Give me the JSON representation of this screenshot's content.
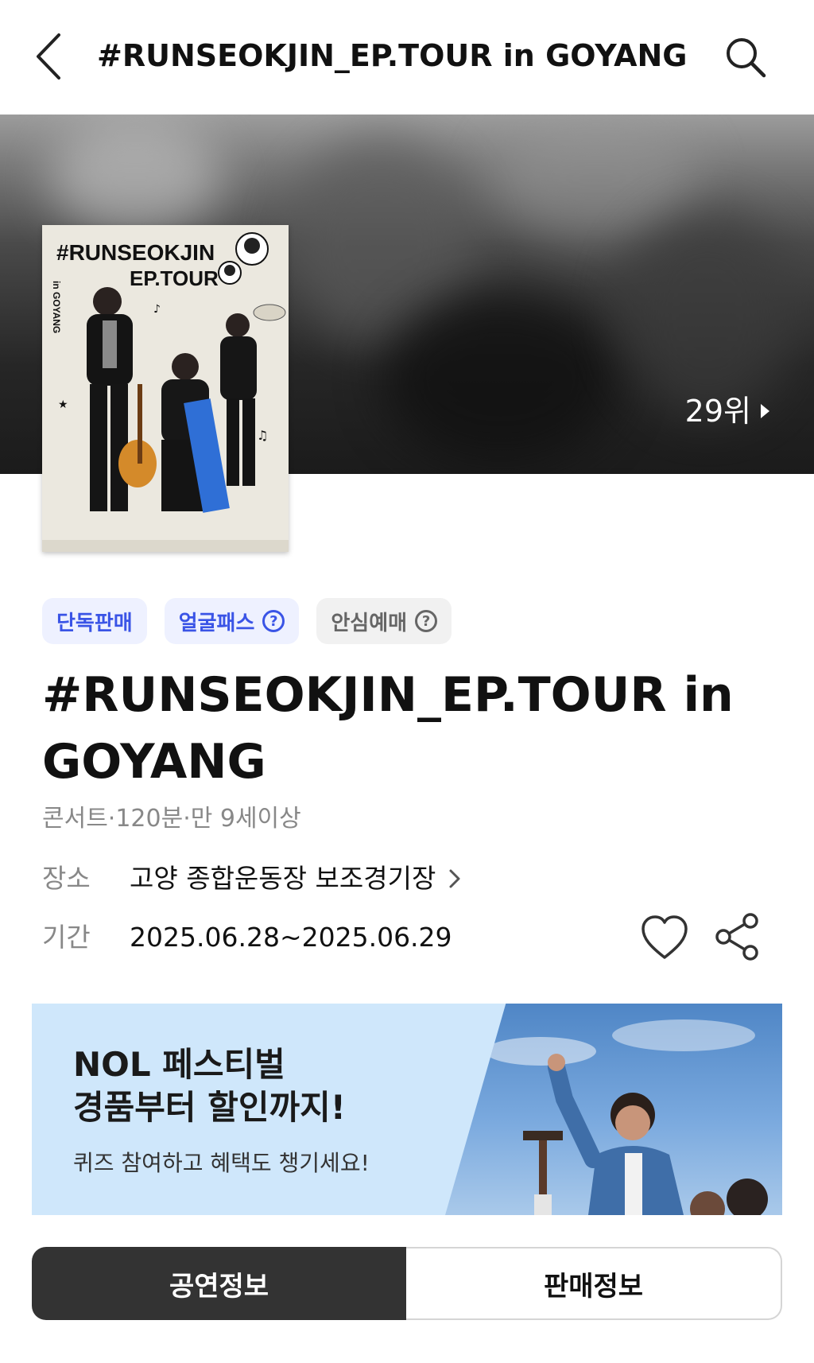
{
  "header": {
    "title": "#RUNSEOKJIN_EP.TOUR in GOYANG |...",
    "back_icon": "chevron-left-icon",
    "search_icon": "search-icon"
  },
  "hero": {
    "rank": "29위",
    "poster": {
      "title_line1": "#RUNSEOKJIN",
      "title_line2": "EP.TOUR",
      "side_text": "in GOYANG"
    }
  },
  "badges": [
    {
      "label": "단독판매",
      "help": false
    },
    {
      "label": "얼굴패스",
      "help": true
    },
    {
      "label": "안심예매",
      "help": true
    }
  ],
  "event": {
    "title": "#RUNSEOKJIN_EP.TOUR in GOYANG",
    "meta": "콘서트·120분·만 9세이상",
    "venue_label": "장소",
    "venue": "고양 종합운동장 보조경기장",
    "period_label": "기간",
    "period": "2025.06.28~2025.06.29"
  },
  "banner": {
    "title_line1": "NOL 페스티벌",
    "title_line2": "경품부터 할인까지!",
    "subtitle": "퀴즈 참여하고 혜택도 챙기세요!"
  },
  "tabs": [
    {
      "label": "공연정보",
      "active": true
    },
    {
      "label": "판매정보",
      "active": false
    }
  ],
  "colors": {
    "accent_blue": "#3a54e6",
    "badge_blue_bg": "#eef1ff",
    "tab_active_bg": "#333333",
    "banner_bg": "#cfe7fb"
  }
}
